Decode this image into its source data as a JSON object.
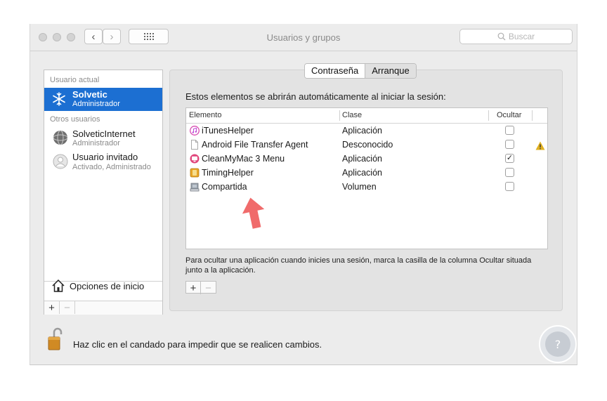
{
  "window": {
    "title": "Usuarios y grupos"
  },
  "search": {
    "placeholder": "Buscar"
  },
  "sidebar": {
    "current_label": "Usuario actual",
    "current_user": {
      "name": "Solvetic",
      "role": "Administrador"
    },
    "others_label": "Otros usuarios",
    "others": [
      {
        "name": "SolveticInternet",
        "role": "Administrador"
      },
      {
        "name": "Usuario invitado",
        "role": "Activado, Administrado"
      }
    ],
    "login_options": "Opciones de inicio"
  },
  "tabs": [
    {
      "label": "Contraseña",
      "active": false
    },
    {
      "label": "Arranque",
      "active": true
    }
  ],
  "login_items": {
    "intro": "Estos elementos se abrirán automáticamente al iniciar la sesión:",
    "columns": [
      "Elemento",
      "Clase",
      "Ocultar"
    ],
    "rows": [
      {
        "name": "iTunesHelper",
        "class": "Aplicación",
        "hidden": false,
        "icon": "itunes-icon",
        "warning": false
      },
      {
        "name": "Android File Transfer Agent",
        "class": "Desconocido",
        "hidden": false,
        "icon": "document-icon",
        "warning": true
      },
      {
        "name": "CleanMyMac 3 Menu",
        "class": "Aplicación",
        "hidden": true,
        "icon": "cleanmymac-icon",
        "warning": false
      },
      {
        "name": "TimingHelper",
        "class": "Aplicación",
        "hidden": false,
        "icon": "timing-icon",
        "warning": false
      },
      {
        "name": "Compartida",
        "class": "Volumen",
        "hidden": false,
        "icon": "volume-icon",
        "warning": false
      }
    ],
    "footnote": "Para ocultar una aplicación cuando inicies una sesión, marca la casilla de la columna Ocultar situada junto a la aplicación."
  },
  "lock": {
    "text": "Haz clic en el candado para impedir que se realicen cambios."
  },
  "colors": {
    "selection": "#1c6fd2",
    "arrow": "#f06b6b",
    "warning": "#e0b020"
  }
}
